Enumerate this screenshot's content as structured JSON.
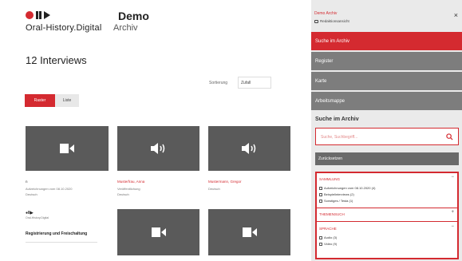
{
  "header": {
    "brand": "Oral-History.Digital",
    "title": "Demo",
    "subtitle": "Archiv"
  },
  "main": {
    "count": "12 Interviews",
    "sort_label": "Sortierung",
    "sort_value": "Zufall",
    "view_raster": "Raster",
    "view_liste": "Liste"
  },
  "cards": [
    {
      "type": "video",
      "title": "n",
      "meta1": "Aufzeichnungen vom 08.10.2020",
      "meta2": "Deutsch"
    },
    {
      "type": "audio",
      "title": "Musterfrau, Anna",
      "meta1": "Veröffentlichung",
      "meta2": "Deutsch"
    },
    {
      "type": "audio",
      "title": "Mustermann, Gregor",
      "meta1": "Deutsch",
      "meta2": ""
    }
  ],
  "text_card": {
    "logo": "●II▶",
    "logo_sub": "Oral-History.Digital",
    "title": "Registrierung und Freischaltung"
  },
  "sidebar": {
    "title": "Demo Archiv",
    "subtitle": "Redaktionsansicht",
    "close": "×",
    "nav": [
      "Suche im Archiv",
      "Register",
      "Karte",
      "Arbeitsmappe"
    ],
    "search_heading": "Suche im Archiv",
    "search_placeholder": "Suche, Suchbegriff...",
    "reset_label": "Zurücksetzen",
    "facets": [
      {
        "label": "SAMMLUNG",
        "items": [
          "Aufzeichnungen vom 08.10.2020 (4)",
          "Beispielinterviews (2)",
          "Sonstiges / Testa (1)"
        ]
      },
      {
        "label": "THEMENSUCH"
      },
      {
        "label": "SPRACHE",
        "items": [
          "Audio (3)",
          "Video (9)"
        ]
      }
    ]
  },
  "colors": {
    "accent": "#d42a30",
    "nav_bg": "#7d7d7d",
    "thumb_bg": "#5a5a5a"
  }
}
